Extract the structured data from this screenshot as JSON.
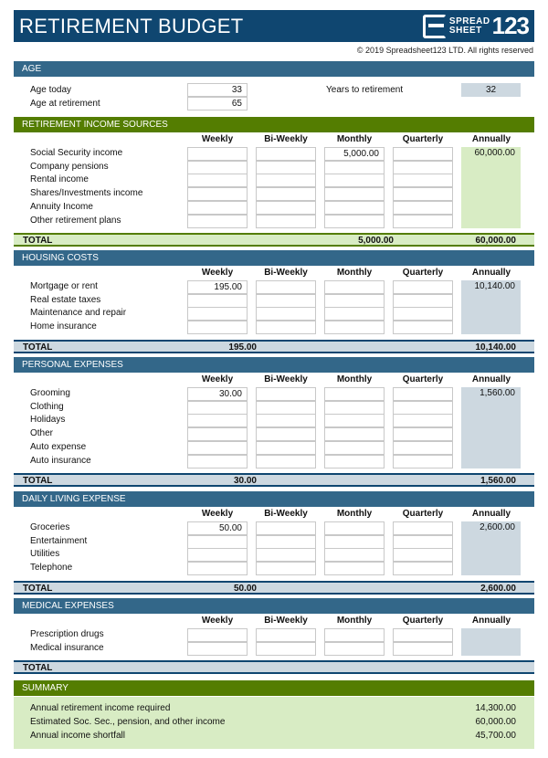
{
  "header": {
    "title": "RETIREMENT BUDGET",
    "logo": {
      "line1": "SPREAD",
      "line2": "SHEET",
      "number": "123"
    },
    "copyright": "© 2019 Spreadsheet123 LTD. All rights reserved"
  },
  "columns": [
    "Weekly",
    "Bi-Weekly",
    "Monthly",
    "Quarterly",
    "Annually"
  ],
  "age": {
    "title": "AGE",
    "age_today_label": "Age today",
    "age_today": "33",
    "age_retirement_label": "Age at retirement",
    "age_retirement": "65",
    "years_label": "Years to retirement",
    "years": "32"
  },
  "income": {
    "title": "RETIREMENT INCOME SOURCES",
    "rows": [
      {
        "label": "Social Security income",
        "weekly": "",
        "biweekly": "",
        "monthly": "5,000.00",
        "quarterly": "",
        "annually": "60,000.00"
      },
      {
        "label": "Company pensions",
        "weekly": "",
        "biweekly": "",
        "monthly": "",
        "quarterly": "",
        "annually": ""
      },
      {
        "label": "Rental income",
        "weekly": "",
        "biweekly": "",
        "monthly": "",
        "quarterly": "",
        "annually": ""
      },
      {
        "label": "Shares/Investments income",
        "weekly": "",
        "biweekly": "",
        "monthly": "",
        "quarterly": "",
        "annually": ""
      },
      {
        "label": "Annuity Income",
        "weekly": "",
        "biweekly": "",
        "monthly": "",
        "quarterly": "",
        "annually": ""
      },
      {
        "label": "Other retirement plans",
        "weekly": "",
        "biweekly": "",
        "monthly": "",
        "quarterly": "",
        "annually": ""
      }
    ],
    "total": {
      "label": "TOTAL",
      "weekly": "",
      "monthly": "5,000.00",
      "annually": "60,000.00"
    }
  },
  "housing": {
    "title": "HOUSING COSTS",
    "rows": [
      {
        "label": "Mortgage or rent",
        "weekly": "195.00",
        "biweekly": "",
        "monthly": "",
        "quarterly": "",
        "annually": "10,140.00"
      },
      {
        "label": "Real estate taxes",
        "weekly": "",
        "biweekly": "",
        "monthly": "",
        "quarterly": "",
        "annually": ""
      },
      {
        "label": "Maintenance and repair",
        "weekly": "",
        "biweekly": "",
        "monthly": "",
        "quarterly": "",
        "annually": ""
      },
      {
        "label": "Home insurance",
        "weekly": "",
        "biweekly": "",
        "monthly": "",
        "quarterly": "",
        "annually": ""
      }
    ],
    "total": {
      "label": "TOTAL",
      "weekly": "195.00",
      "monthly": "",
      "annually": "10,140.00"
    }
  },
  "personal": {
    "title": "PERSONAL EXPENSES",
    "rows": [
      {
        "label": "Grooming",
        "weekly": "30.00",
        "biweekly": "",
        "monthly": "",
        "quarterly": "",
        "annually": "1,560.00"
      },
      {
        "label": "Clothing",
        "weekly": "",
        "biweekly": "",
        "monthly": "",
        "quarterly": "",
        "annually": ""
      },
      {
        "label": "Holidays",
        "weekly": "",
        "biweekly": "",
        "monthly": "",
        "quarterly": "",
        "annually": ""
      },
      {
        "label": "Other",
        "weekly": "",
        "biweekly": "",
        "monthly": "",
        "quarterly": "",
        "annually": ""
      },
      {
        "label": "Auto expense",
        "weekly": "",
        "biweekly": "",
        "monthly": "",
        "quarterly": "",
        "annually": ""
      },
      {
        "label": "Auto insurance",
        "weekly": "",
        "biweekly": "",
        "monthly": "",
        "quarterly": "",
        "annually": ""
      }
    ],
    "total": {
      "label": "TOTAL",
      "weekly": "30.00",
      "monthly": "",
      "annually": "1,560.00"
    }
  },
  "daily": {
    "title": "DAILY LIVING EXPENSE",
    "rows": [
      {
        "label": "Groceries",
        "weekly": "50.00",
        "biweekly": "",
        "monthly": "",
        "quarterly": "",
        "annually": "2,600.00"
      },
      {
        "label": "Entertainment",
        "weekly": "",
        "biweekly": "",
        "monthly": "",
        "quarterly": "",
        "annually": ""
      },
      {
        "label": "Utilities",
        "weekly": "",
        "biweekly": "",
        "monthly": "",
        "quarterly": "",
        "annually": ""
      },
      {
        "label": "Telephone",
        "weekly": "",
        "biweekly": "",
        "monthly": "",
        "quarterly": "",
        "annually": ""
      }
    ],
    "total": {
      "label": "TOTAL",
      "weekly": "50.00",
      "monthly": "",
      "annually": "2,600.00"
    }
  },
  "medical": {
    "title": "MEDICAL EXPENSES",
    "rows": [
      {
        "label": "Prescription drugs",
        "weekly": "",
        "biweekly": "",
        "monthly": "",
        "quarterly": "",
        "annually": ""
      },
      {
        "label": "Medical insurance",
        "weekly": "",
        "biweekly": "",
        "monthly": "",
        "quarterly": "",
        "annually": ""
      }
    ],
    "total": {
      "label": "TOTAL",
      "weekly": "",
      "monthly": "",
      "annually": ""
    }
  },
  "summary": {
    "title": "SUMMARY",
    "rows": [
      {
        "label": "Annual retirement income required",
        "value": "14,300.00"
      },
      {
        "label": "Estimated Soc. Sec., pension, and other income",
        "value": "60,000.00"
      },
      {
        "label": "Annual income shortfall",
        "value": "45,700.00"
      }
    ]
  }
}
